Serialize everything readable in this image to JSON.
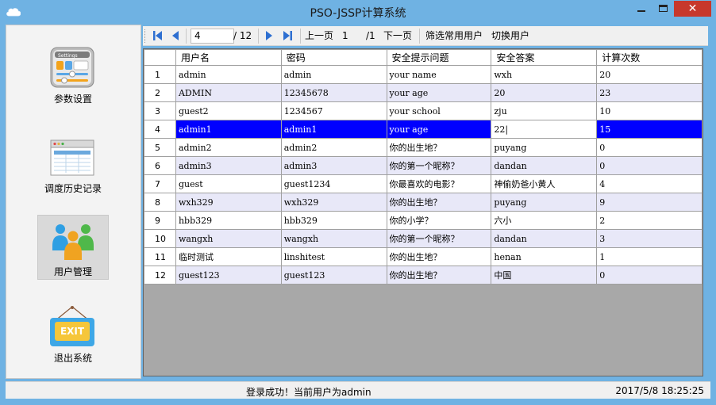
{
  "window": {
    "title": "PSO-JSSP计算系统",
    "close_label": "✕"
  },
  "sidebar": {
    "items": [
      {
        "label": "参数设置",
        "badge": "Settings"
      },
      {
        "label": "调度历史记录"
      },
      {
        "label": "用户管理",
        "active": true
      },
      {
        "label": "退出系统",
        "badge": "EXIT"
      }
    ]
  },
  "toolbar": {
    "current_position": "4",
    "total_count": "/ 12",
    "prev_page_label": "上一页",
    "page_number": "1",
    "total_pages": "/1",
    "next_page_label": "下一页",
    "filter_label": "筛选常用用户",
    "switch_label": "切换用户"
  },
  "grid": {
    "columns": [
      "用户名",
      "密码",
      "安全提示问题",
      "安全答案",
      "计算次数"
    ],
    "rows": [
      {
        "n": "1",
        "cells": [
          "admin",
          "admin",
          "your name",
          "wxh",
          "20"
        ]
      },
      {
        "n": "2",
        "cells": [
          "ADMIN",
          "12345678",
          "your age",
          "20",
          "23"
        ]
      },
      {
        "n": "3",
        "cells": [
          "guest2",
          "1234567",
          "your school",
          "zju",
          "10"
        ]
      },
      {
        "n": "4",
        "cells": [
          "admin1",
          "admin1",
          "your age",
          "22|",
          "15"
        ]
      },
      {
        "n": "5",
        "cells": [
          "admin2",
          "admin2",
          "你的出生地？",
          "puyang",
          "0"
        ]
      },
      {
        "n": "6",
        "cells": [
          "admin3",
          "admin3",
          "你的第一个昵称？",
          "dandan",
          "0"
        ]
      },
      {
        "n": "7",
        "cells": [
          "guest",
          "guest1234",
          "你最喜欢的电影？",
          "神偷奶爸小黄人",
          "4"
        ]
      },
      {
        "n": "8",
        "cells": [
          "wxh329",
          "wxh329",
          "你的出生地？",
          "puyang",
          "9"
        ]
      },
      {
        "n": "9",
        "cells": [
          "hbb329",
          "hbb329",
          "你的小学？",
          "六小",
          "2"
        ]
      },
      {
        "n": "10",
        "cells": [
          "wangxh",
          "wangxh",
          "你的第一个昵称？",
          "dandan",
          "3"
        ]
      },
      {
        "n": "11",
        "cells": [
          "临时测试",
          "linshitest",
          "你的出生地？",
          "henan",
          "1"
        ]
      },
      {
        "n": "12",
        "cells": [
          "guest123",
          "guest123",
          "你的出生地？",
          "中国",
          "0"
        ]
      }
    ]
  },
  "status": {
    "message": "登录成功！当前用户为admin",
    "datetime": "2017/5/8 18:25:25"
  },
  "colors": {
    "title_bar": "#6fb2e3",
    "selection": "#0000ff",
    "alt_row": "#e8e8f8",
    "close_button": "#c7382c"
  }
}
